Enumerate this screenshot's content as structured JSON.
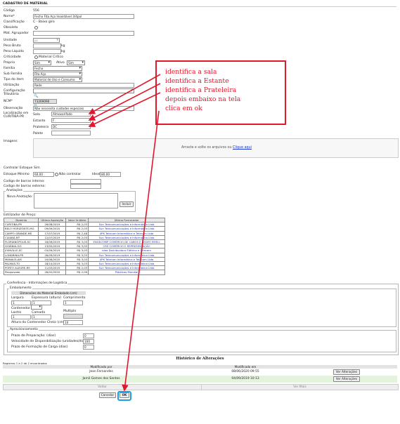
{
  "header": {
    "title": "CADASTRO DE MATERIAL"
  },
  "form": {
    "codigo_label": "Código",
    "codigo_value": "556",
    "nome_label": "Nome*",
    "nome_value": "Fecho Fita Aço Inoxidável 3/4pol",
    "classificacao_label": "Classificação",
    "classificacao_value": "C - Baixo giro",
    "obsoleto_label": "Obsoleto",
    "mat_agrupador_label": "Mat. Agrupador",
    "unidade_label": "Unidade",
    "unidade_value": "pc",
    "peso_bruto_label": "Peso Bruto",
    "peso_bruto_unit": "kg",
    "peso_liquido_label": "Peso Líquido",
    "peso_liquido_unit": "kg",
    "criticidade_label": "Criticidade",
    "criticidade_option": "Material Crítico",
    "proprio_label": "Proprio",
    "proprio_value": "Sim",
    "ativo_label": "Ativo",
    "ativo_value": "Sim",
    "familia_label": "Família",
    "familia_value": "Fecho",
    "sub_familia_label": "Sub Família",
    "sub_familia_value": "Fita Aço",
    "tipo_item_label": "Tipo do item",
    "tipo_item_value": "Material de Uso e Consumo",
    "utilizacao_label": "Utilização",
    "utilizacao_value": "Rede",
    "config_tributaria_label": "Configuração Tributária",
    "ncm_label": "NCM*",
    "ncm_value": "73269090",
    "observacao_label": "Observação",
    "observacao_value": "Não necessita cuidados especiais",
    "localizacao_label": "Localização em CURITIBA-PR",
    "sala_label": "Sala",
    "sala_value": "Almoxarifado",
    "estante_label": "Estante",
    "estante_value": "F",
    "prateleira_label": "Prateleira",
    "prateleira_value": "DC",
    "palete_label": "Palete",
    "imagens_label": "Imagens",
    "dropzone_text": "Arraste e solte os arquivos ou",
    "dropzone_link": "Clique aqui"
  },
  "stock": {
    "controlar_label": "Controlar Estoque",
    "controlar_value": "Sim",
    "minimo_label": "Estoque Mínimo",
    "minimo_value": "60,00",
    "nao_controlar_label": "Não controlar",
    "ideal_label": "Ideal",
    "ideal_value": "80,00",
    "barcode_interno_label": "Codigo de barras interno:",
    "barcode_externo_label": "Codigo de barras externo:",
    "anotacoes_legend": "Anotações",
    "nova_anotacao_label": "Nova Anotação:",
    "incluir_button": "Incluir"
  },
  "prices": {
    "label": "Estilizador de Preço:",
    "headers": [
      "Domínio",
      "Última Aquisição",
      "Valor Unitário",
      "Último Fornecedor"
    ],
    "rows": [
      [
        "CURITIBA-PR",
        "26/08/2019",
        "R$ 2,03",
        "Sun Telecomunicações e Informática Ltda"
      ],
      [
        "BELO HORIZONTE-MG",
        "09/09/2020",
        "R$ 2,03",
        "Sun Telecomunicações e Informática Ltda"
      ],
      [
        "CAMPO GRANDE-MS",
        "17/07/2019",
        "R$ 2,48",
        "4PK Telecom Informática e Telecom Ltda"
      ],
      [
        "CUIABÁ-MT",
        "12/07/2019",
        "R$ 2,03",
        "Sun Telecomunicações e Informática Ltda"
      ],
      [
        "FLORIANÓPOLIS-SC",
        "16/09/2019",
        "R$ 3,03",
        "ENGECOMP COMÉRCIO DE CABOS E REDES EIRELI"
      ],
      [
        "GOIÂNIA-GO",
        "13/05/2019",
        "R$ 3,03",
        "CRS COMÉRCIO E REPRESENTAÇÃO"
      ],
      [
        "JOINVILLE-SC",
        "03/09/2019",
        "R$ 3,03",
        "Idea Distribuidora Elétrica e Telecom"
      ],
      [
        "LONDRINA-PR",
        "26/09/2019",
        "R$ 3,03",
        "Sun Telecomunicações e Informática Ltda"
      ],
      [
        "MANAUS-AM",
        "20/08/2020",
        "R$ 3,03",
        "4PK Telecom Informática e Telecom Ltda"
      ],
      [
        "PALMAS-TO",
        "18/10/2019",
        "R$ 3,03",
        "Sun Telecomunicações e Informática Ltda"
      ],
      [
        "PORTO ALEGRE-RS",
        "11/03/2019",
        "R$ 2,03",
        "Sun Telecomunicações e Informática Ltda"
      ],
      [
        "Pesquisado",
        "26/02/2020",
        "R$ 2,09",
        "Plásticos Mundial"
      ]
    ]
  },
  "logistics": {
    "legend": "Conferência - Informações de Logística",
    "embalamento_legend": "Embalamento",
    "dim_title": "Dimensões do Material Embalado (cm)",
    "largura_label": "Largura",
    "largura_value": "1",
    "espessura_label": "Espessura (altura)",
    "espessura_value": "1",
    "comprimento_label": "Comprimento",
    "comprimento_value": "1",
    "contenedor_label": "Contenedor",
    "lastro_label": "Lastro",
    "lastro_value": "1",
    "camada_label": "Camada",
    "camada_value": "1",
    "multiplo_label": "Multiplo",
    "altura_label": "Altura do Contenedor Cheio (cm)",
    "altura_value": "10",
    "aprov_legend": "Aprovisionamento",
    "prazo_prep_label": "Prazo de Preparação: (dias)",
    "prazo_prep_value": "0",
    "velocidade_label": "Velocidade de Disponibilização (unidades/dia)",
    "velocidade_value": "100",
    "prazo_carga_label": "Prazo de Formação de Carga (dias)",
    "prazo_carga_value": "0"
  },
  "history": {
    "title": "Histórico de Alterações",
    "count_text": "Registros 1 a 2 de 2 encontrados",
    "col_by": "Modificado por",
    "col_at": "Modificado em",
    "rows": [
      {
        "by": "Jean Fernandes",
        "at": "08/06/2020 09:55",
        "button": "Ver Alterações"
      },
      {
        "by": "Jamil Gomes dos Santos",
        "at": "04/09/2019 10:13",
        "button": "Ver Alterações"
      }
    ],
    "prev": "Voltar",
    "next": "Ver Mais"
  },
  "actions": {
    "cancel": "Cancelar",
    "ok": "OK"
  },
  "callout": {
    "line1": "identifica a sala",
    "line2": "identifica a Estante",
    "line3": "identifica a Prateleira",
    "line4": "depois embaixo na tela",
    "line5": "clica em ok"
  },
  "colors": {
    "annotation": "#e0182d",
    "ok_highlight": "#1a9fe0",
    "history_row": "#e4f4dc",
    "link": "#1c35c9"
  }
}
